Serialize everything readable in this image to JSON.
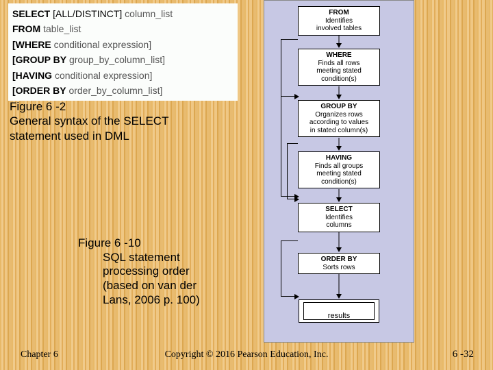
{
  "syntax": {
    "l1a": "SELECT",
    "l1b": " [ALL/DISTINCT] ",
    "l1c": "column_list",
    "l2a": "FROM",
    "l2b": " table_list",
    "l3a": "[WHERE",
    "l3b": " conditional expression]",
    "l4a": "[GROUP BY",
    "l4b": " group_by_column_list]",
    "l5a": "[HAVING",
    "l5b": " conditional expression]",
    "l6a": "[ORDER BY",
    "l6b": " order_by_column_list]"
  },
  "fig62": {
    "line1": "Figure 6 -2",
    "line2": "General syntax of the SELECT",
    "line3": "statement used in DML"
  },
  "fig610": {
    "line1": "Figure 6 -10",
    "line2": "SQL statement",
    "line3": "processing order",
    "line4": "(based on van der",
    "line5": "Lans, 2006 p. 100)"
  },
  "flow": {
    "b1t": "FROM",
    "b1d": "Identifies\ninvolved tables",
    "b2t": "WHERE",
    "b2d": "Finds all rows\nmeeting stated\ncondition(s)",
    "b3t": "GROUP BY",
    "b3d": "Organizes rows\naccording to values\nin stated column(s)",
    "b4t": "HAVING",
    "b4d": "Finds all groups\nmeeting stated\ncondition(s)",
    "b5t": "SELECT",
    "b5d": "Identifies\ncolumns",
    "b6t": "ORDER BY",
    "b6d": "Sorts rows",
    "b7": "results"
  },
  "footer": {
    "left": "Chapter 6",
    "center": "Copyright © 2016 Pearson Education, Inc.",
    "right": "6 -32"
  }
}
